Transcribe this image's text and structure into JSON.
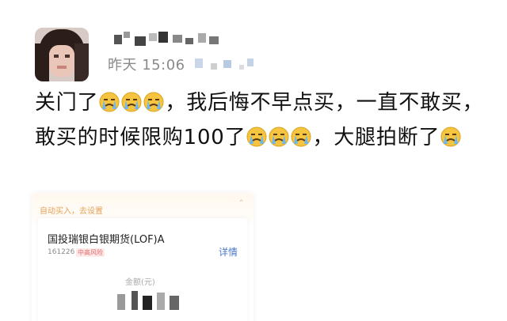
{
  "post": {
    "timestamp": "昨天 15:06",
    "text_parts": {
      "p1": "关门了",
      "p2": "，我后悔不早点买，一直不敢买，敢买的时候限购100了",
      "p3": "，大腿拍断了"
    },
    "emoji_name": "crying-face-icon"
  },
  "card": {
    "top_text": "自动买入，去设置",
    "fund_name": "国投瑞银白银期货(LOF)A",
    "fund_code": "161226",
    "fund_tag": "中高风险",
    "detail_label": "详情",
    "amount_label": "金额(元)"
  },
  "colors": {
    "text": "#111111",
    "timestamp": "#8a8a8a",
    "link": "#4a78c8",
    "card_accent": "#e6a158"
  }
}
